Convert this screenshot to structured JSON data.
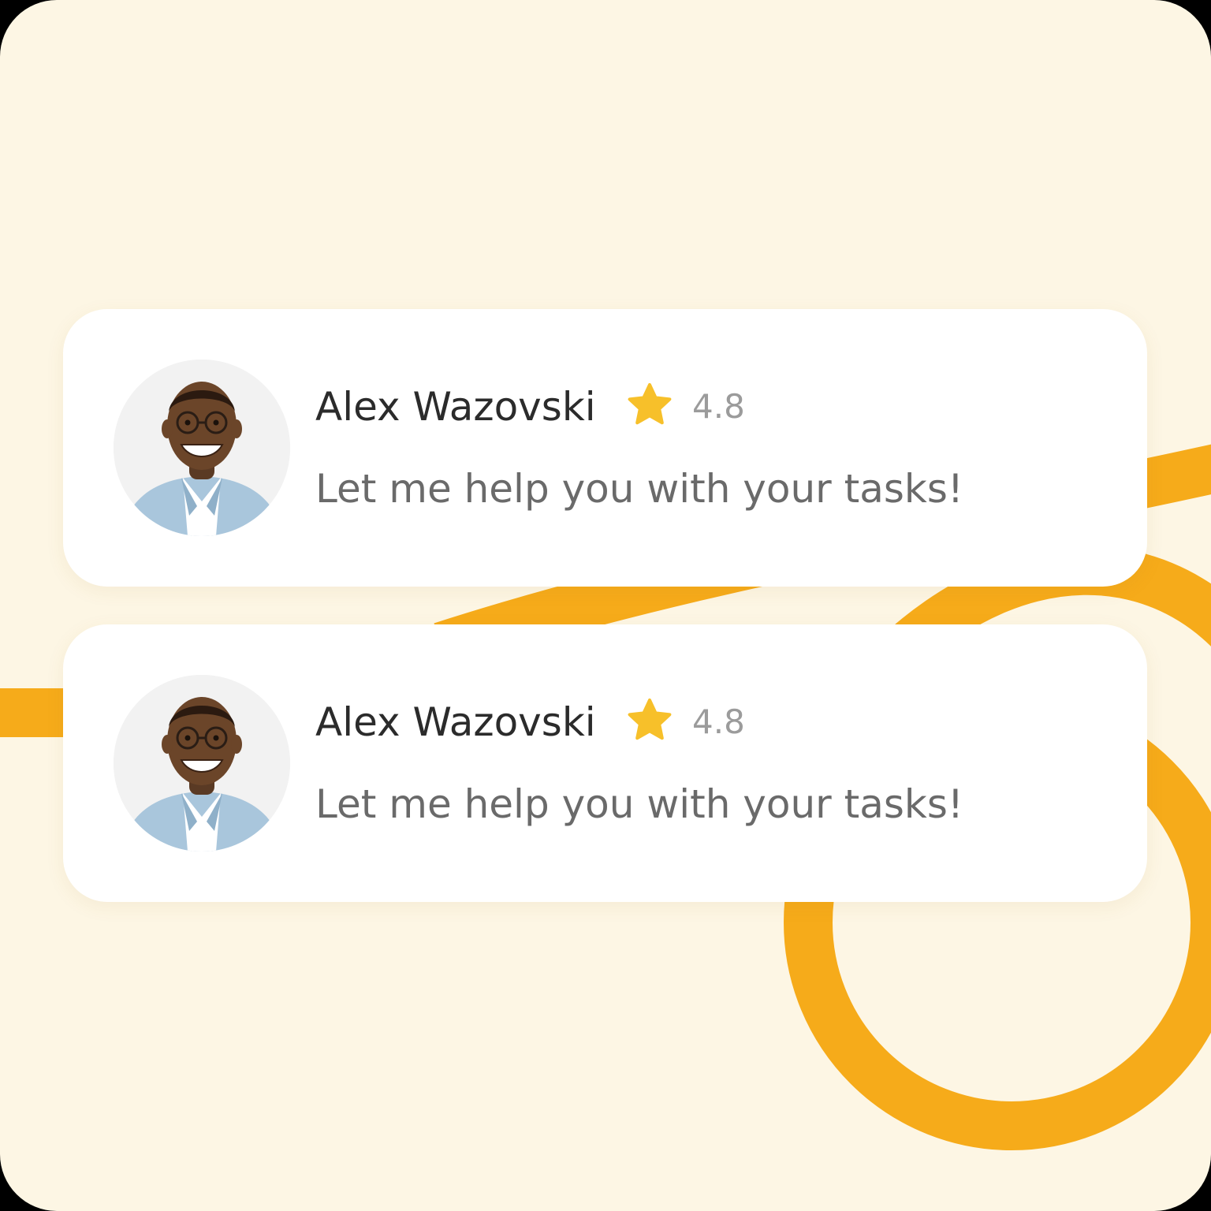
{
  "colors": {
    "background": "#fdf6e4",
    "accent": "#f6ab1a",
    "card": "#ffffff",
    "name_text": "#2b2b2b",
    "rating_text": "#9b9b9b",
    "message_text": "#6a6a6a"
  },
  "cards": [
    {
      "avatar_icon": "person-avatar",
      "name": "Alex Wazovski",
      "rating_icon": "star-icon",
      "rating": "4.8",
      "message": "Let me help you with your tasks!"
    },
    {
      "avatar_icon": "person-avatar",
      "name": "Alex Wazovski",
      "rating_icon": "star-icon",
      "rating": "4.8",
      "message": "Let me help you with your tasks!"
    }
  ]
}
